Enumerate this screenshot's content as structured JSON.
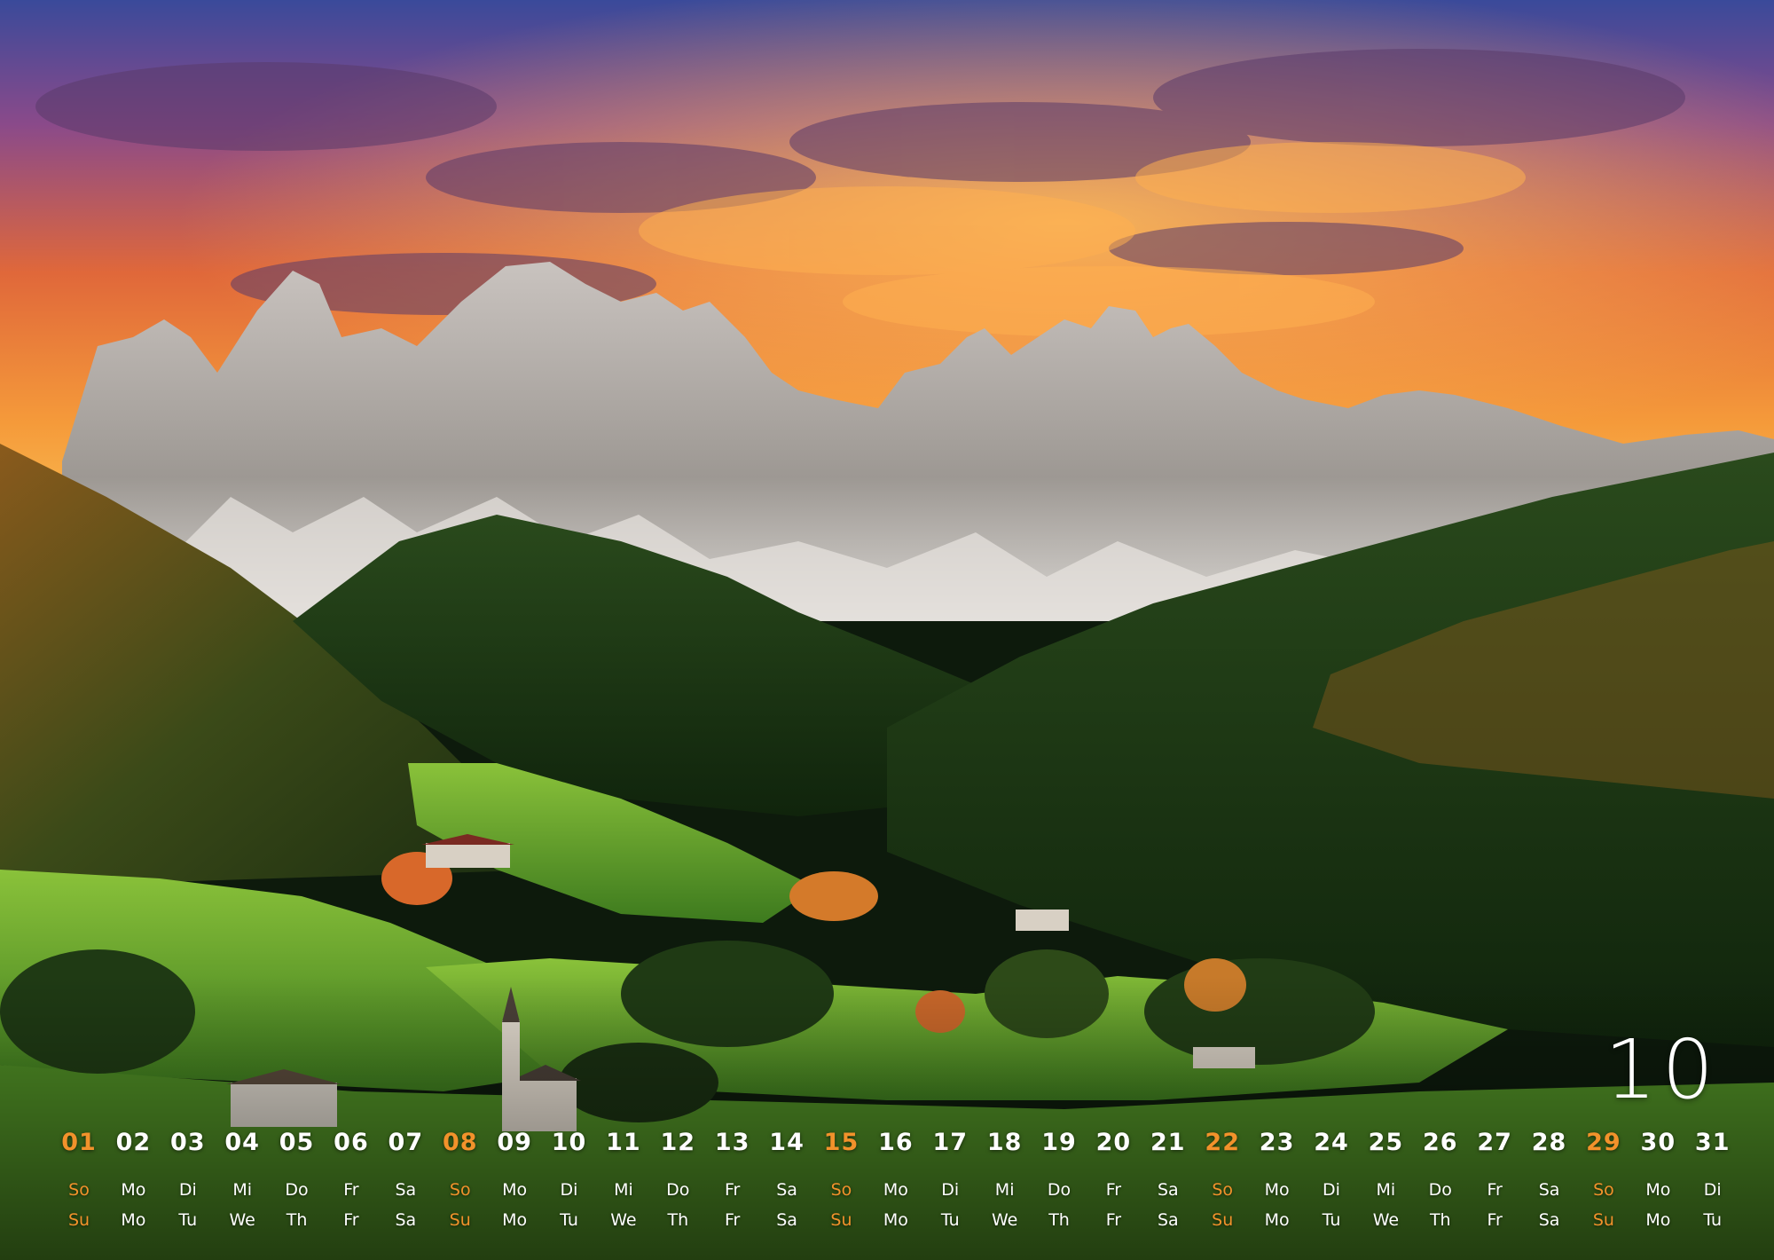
{
  "month": {
    "number": "10"
  },
  "colors": {
    "text": "#ffffff",
    "sunday": "#f2922b"
  },
  "calendar": {
    "days": [
      {
        "num": "01",
        "de": "So",
        "en": "Su",
        "sunday": true
      },
      {
        "num": "02",
        "de": "Mo",
        "en": "Mo",
        "sunday": false
      },
      {
        "num": "03",
        "de": "Di",
        "en": "Tu",
        "sunday": false
      },
      {
        "num": "04",
        "de": "Mi",
        "en": "We",
        "sunday": false
      },
      {
        "num": "05",
        "de": "Do",
        "en": "Th",
        "sunday": false
      },
      {
        "num": "06",
        "de": "Fr",
        "en": "Fr",
        "sunday": false
      },
      {
        "num": "07",
        "de": "Sa",
        "en": "Sa",
        "sunday": false
      },
      {
        "num": "08",
        "de": "So",
        "en": "Su",
        "sunday": true
      },
      {
        "num": "09",
        "de": "Mo",
        "en": "Mo",
        "sunday": false
      },
      {
        "num": "10",
        "de": "Di",
        "en": "Tu",
        "sunday": false
      },
      {
        "num": "11",
        "de": "Mi",
        "en": "We",
        "sunday": false
      },
      {
        "num": "12",
        "de": "Do",
        "en": "Th",
        "sunday": false
      },
      {
        "num": "13",
        "de": "Fr",
        "en": "Fr",
        "sunday": false
      },
      {
        "num": "14",
        "de": "Sa",
        "en": "Sa",
        "sunday": false
      },
      {
        "num": "15",
        "de": "So",
        "en": "Su",
        "sunday": true
      },
      {
        "num": "16",
        "de": "Mo",
        "en": "Mo",
        "sunday": false
      },
      {
        "num": "17",
        "de": "Di",
        "en": "Tu",
        "sunday": false
      },
      {
        "num": "18",
        "de": "Mi",
        "en": "We",
        "sunday": false
      },
      {
        "num": "19",
        "de": "Do",
        "en": "Th",
        "sunday": false
      },
      {
        "num": "20",
        "de": "Fr",
        "en": "Fr",
        "sunday": false
      },
      {
        "num": "21",
        "de": "Sa",
        "en": "Sa",
        "sunday": false
      },
      {
        "num": "22",
        "de": "So",
        "en": "Su",
        "sunday": true
      },
      {
        "num": "23",
        "de": "Mo",
        "en": "Mo",
        "sunday": false
      },
      {
        "num": "24",
        "de": "Di",
        "en": "Tu",
        "sunday": false
      },
      {
        "num": "25",
        "de": "Mi",
        "en": "We",
        "sunday": false
      },
      {
        "num": "26",
        "de": "Do",
        "en": "Th",
        "sunday": false
      },
      {
        "num": "27",
        "de": "Fr",
        "en": "Fr",
        "sunday": false
      },
      {
        "num": "28",
        "de": "Sa",
        "en": "Sa",
        "sunday": false
      },
      {
        "num": "29",
        "de": "So",
        "en": "Su",
        "sunday": true
      },
      {
        "num": "30",
        "de": "Mo",
        "en": "Mo",
        "sunday": false
      },
      {
        "num": "31",
        "de": "Di",
        "en": "Tu",
        "sunday": false
      }
    ]
  }
}
